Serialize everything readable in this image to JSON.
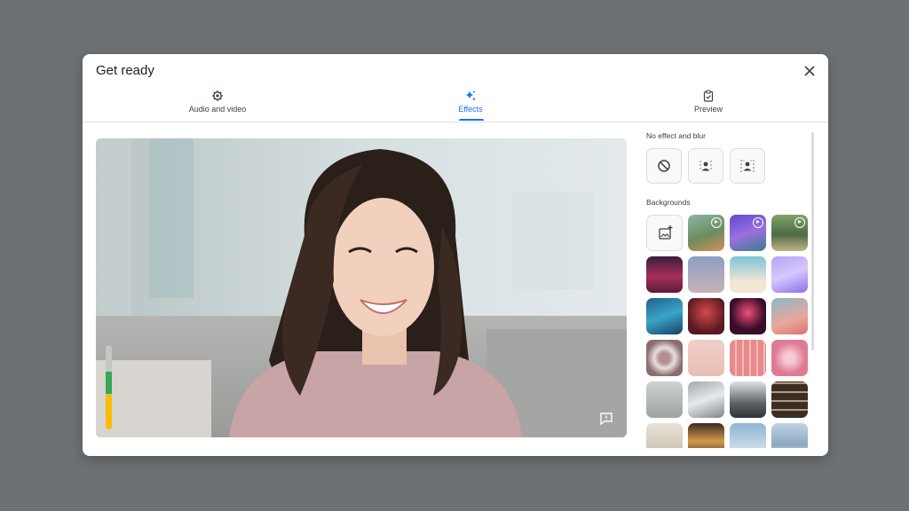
{
  "dialog": {
    "title": "Get ready",
    "close_icon": "close-icon"
  },
  "tabs": [
    {
      "label": "Audio and video",
      "icon": "gear-icon",
      "active": false
    },
    {
      "label": "Effects",
      "icon": "sparkle-icon",
      "active": true
    },
    {
      "label": "Preview",
      "icon": "clipboard-check-icon",
      "active": false
    }
  ],
  "effects": {
    "title": "No effect and blur",
    "items": [
      {
        "name": "no-effect",
        "icon": "block-icon"
      },
      {
        "name": "slight-blur",
        "icon": "blur-slight-icon"
      },
      {
        "name": "blur",
        "icon": "blur-icon"
      }
    ]
  },
  "backgrounds": {
    "title": "Backgrounds",
    "upload_icon": "add-image-icon"
  },
  "mic_level": 0.55,
  "colors": {
    "accent": "#1a73e8"
  }
}
